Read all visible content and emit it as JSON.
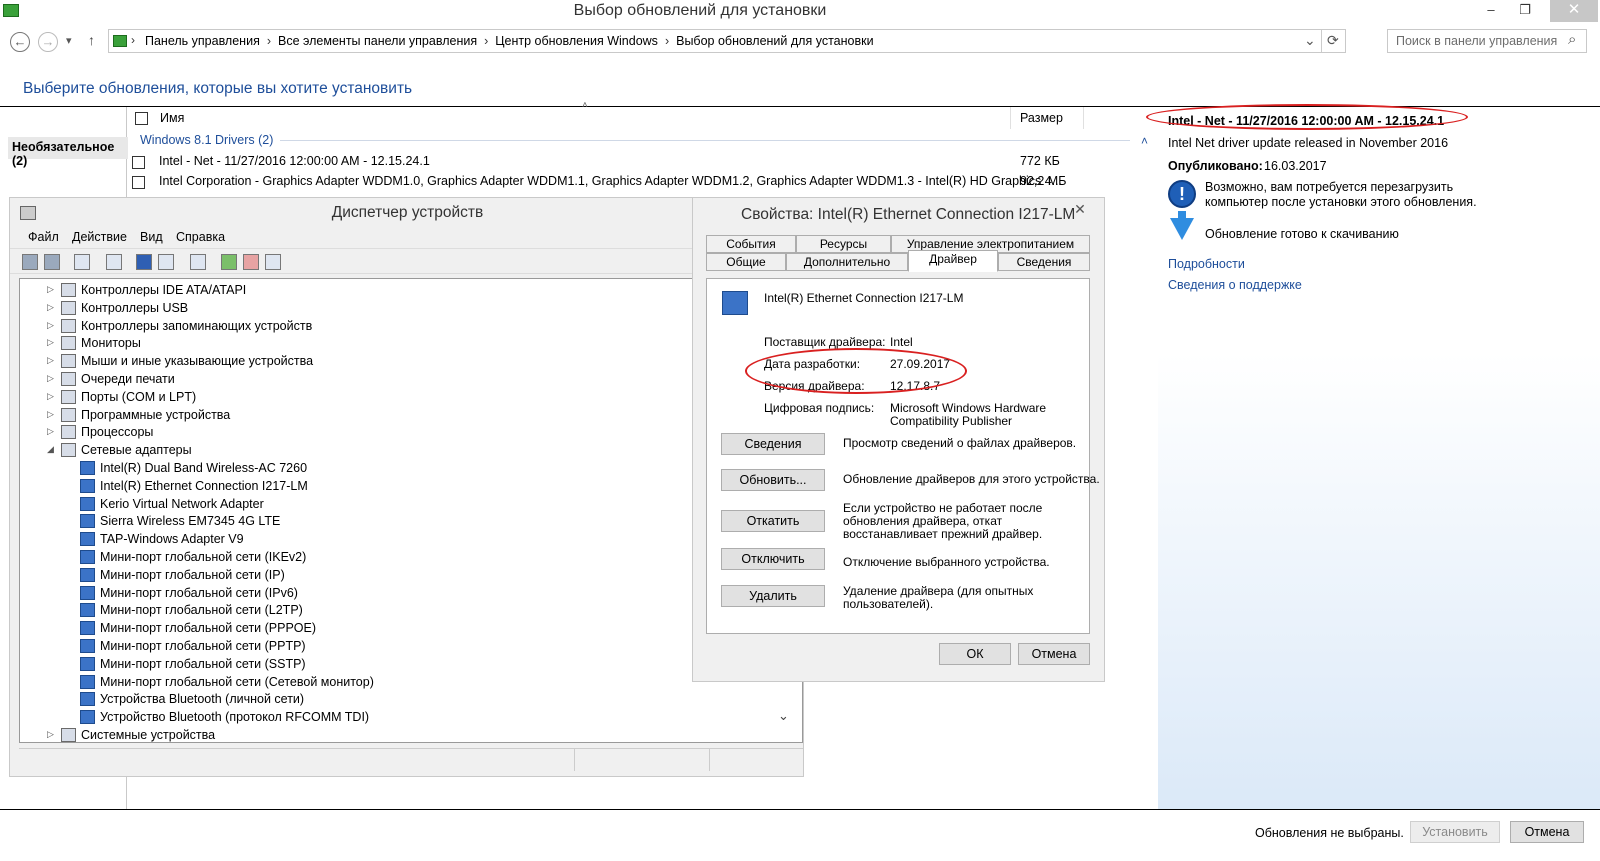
{
  "window": {
    "title": "Выбор обновлений для установки",
    "minimize": "–",
    "restore": "❐",
    "close": "✕"
  },
  "nav": {
    "back": "←",
    "forward": "→",
    "dropdown": "▾",
    "up": "↑",
    "breadcrumbs": [
      "Панель управления",
      "Все элементы панели управления",
      "Центр обновления Windows",
      "Выбор обновлений для установки"
    ],
    "breadcrumb_sep": "›",
    "address_dropdown": "⌄",
    "refresh": "⟳",
    "search_placeholder": "Поиск в панели управления",
    "search_icon": "⌕"
  },
  "heading": "Выберите обновления, которые вы хотите установить",
  "category": "Необязательное (2)",
  "list": {
    "col_name": "Имя",
    "col_size": "Размер",
    "sort_glyph": "˄",
    "group": "Windows 8.1 Drivers (2)",
    "collapse": "˄",
    "rows": [
      {
        "name": "Intel - Net - 11/27/2016 12:00:00 AM - 12.15.24.1",
        "size": "772 КБ"
      },
      {
        "name": "Intel Corporation - Graphics Adapter WDDM1.0, Graphics Adapter WDDM1.1, Graphics Adapter WDDM1.2, Graphics Adapter WDDM1.3 - Intel(R) HD Graphics 4...",
        "size": "92,2 МБ"
      }
    ]
  },
  "details": {
    "title": "Intel - Net - 11/27/2016 12:00:00 AM - 12.15.24.1",
    "description": "Intel Net  driver update released in  November 2016",
    "published_label": "Опубликовано:",
    "published_value": "16.03.2017",
    "restart_note": "Возможно, вам потребуется перезагрузить компьютер после установки этого обновления.",
    "download_note": "Обновление готово к скачиванию",
    "link_more": "Подробности",
    "link_support": "Сведения о поддержке"
  },
  "footer": {
    "status": "Обновления не выбраны.",
    "install": "Установить",
    "cancel": "Отмена"
  },
  "devmgr": {
    "title": "Диспетчер устройств",
    "menu": [
      "Файл",
      "Действие",
      "Вид",
      "Справка"
    ],
    "tree": [
      {
        "label": "Контроллеры IDE ATA/ATAPI",
        "level": 0,
        "arrow": "▷"
      },
      {
        "label": "Контроллеры USB",
        "level": 0,
        "arrow": "▷"
      },
      {
        "label": "Контроллеры запоминающих устройств",
        "level": 0,
        "arrow": "▷"
      },
      {
        "label": "Мониторы",
        "level": 0,
        "arrow": "▷"
      },
      {
        "label": "Мыши и иные указывающие устройства",
        "level": 0,
        "arrow": "▷"
      },
      {
        "label": "Очереди печати",
        "level": 0,
        "arrow": "▷"
      },
      {
        "label": "Порты (COM и LPT)",
        "level": 0,
        "arrow": "▷"
      },
      {
        "label": "Программные устройства",
        "level": 0,
        "arrow": "▷"
      },
      {
        "label": "Процессоры",
        "level": 0,
        "arrow": "▷"
      },
      {
        "label": "Сетевые адаптеры",
        "level": 0,
        "arrow": "◢"
      },
      {
        "label": "Intel(R) Dual Band Wireless-AC 7260",
        "level": 1
      },
      {
        "label": "Intel(R) Ethernet Connection I217-LM",
        "level": 1
      },
      {
        "label": "Kerio Virtual Network Adapter",
        "level": 1
      },
      {
        "label": "Sierra Wireless EM7345 4G LTE",
        "level": 1
      },
      {
        "label": "TAP-Windows Adapter V9",
        "level": 1
      },
      {
        "label": "Мини-порт глобальной сети (IKEv2)",
        "level": 1
      },
      {
        "label": "Мини-порт глобальной сети (IP)",
        "level": 1
      },
      {
        "label": "Мини-порт глобальной сети (IPv6)",
        "level": 1
      },
      {
        "label": "Мини-порт глобальной сети (L2TP)",
        "level": 1
      },
      {
        "label": "Мини-порт глобальной сети (PPPOE)",
        "level": 1
      },
      {
        "label": "Мини-порт глобальной сети (PPTP)",
        "level": 1
      },
      {
        "label": "Мини-порт глобальной сети (SSTP)",
        "level": 1
      },
      {
        "label": "Мини-порт глобальной сети (Сетевой монитор)",
        "level": 1
      },
      {
        "label": "Устройства Bluetooth (личной сети)",
        "level": 1
      },
      {
        "label": "Устройство Bluetooth (протокол RFCOMM TDI)",
        "level": 1
      },
      {
        "label": "Системные устройства",
        "level": 0,
        "arrow": "▷"
      }
    ],
    "scroll_down": "⌄"
  },
  "props": {
    "title": "Свойства: Intel(R) Ethernet Connection I217-LM",
    "close": "✕",
    "tabs_row1": [
      "События",
      "Ресурсы",
      "Управление электропитанием"
    ],
    "tabs_row2": [
      "Общие",
      "Дополнительно",
      "Драйвер",
      "Сведения"
    ],
    "device_name": "Intel(R) Ethernet Connection I217-LM",
    "provider_label": "Поставщик драйвера:",
    "provider_value": "Intel",
    "date_label": "Дата разработки:",
    "date_value": "27.09.2017",
    "version_label": "Версия драйвера:",
    "version_value": "12.17.8.7",
    "signer_label": "Цифровая подпись:",
    "signer_value_1": "Microsoft Windows Hardware",
    "signer_value_2": "Compatibility Publisher",
    "actions": [
      {
        "button": "Сведения",
        "desc": [
          "Просмотр сведений о файлах драйверов."
        ]
      },
      {
        "button": "Обновить...",
        "desc": [
          "Обновление драйверов для этого устройства."
        ]
      },
      {
        "button": "Откатить",
        "desc": [
          "Если устройство не работает после",
          "обновления драйвера, откат",
          "восстанавливает прежний драйвер."
        ]
      },
      {
        "button": "Отключить",
        "desc": [
          "Отключение выбранного устройства."
        ]
      },
      {
        "button": "Удалить",
        "desc": [
          "Удаление драйвера (для опытных",
          "пользователей)."
        ]
      }
    ],
    "ok": "ОК",
    "cancel": "Отмена"
  },
  "colors": {
    "link": "#1e4e9a",
    "highlight": "#d92020",
    "pane_gradient_end": "#dbe9f8"
  }
}
